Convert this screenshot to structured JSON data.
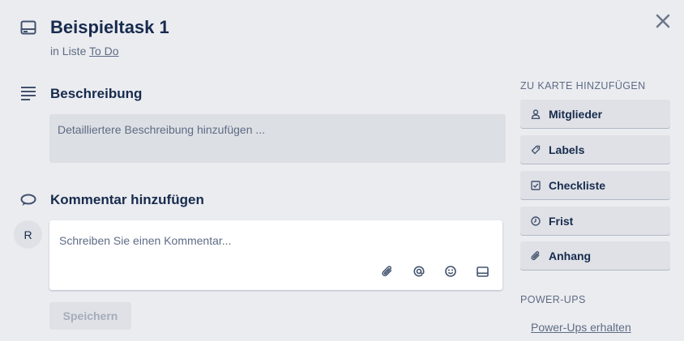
{
  "card": {
    "title": "Beispieltask 1",
    "list_prefix": "in Liste",
    "list_name": "To Do"
  },
  "description": {
    "heading": "Beschreibung",
    "placeholder": "Detailliertere Beschreibung hinzufügen ..."
  },
  "comment": {
    "heading": "Kommentar hinzufügen",
    "avatar_initial": "R",
    "placeholder": "Schreiben Sie einen Kommentar...",
    "save_label": "Speichern",
    "icons": [
      "paperclip-icon",
      "at-mention-icon",
      "emoji-icon",
      "card-icon"
    ]
  },
  "sidebar": {
    "add_heading": "ZU KARTE HINZUFÜGEN",
    "buttons": [
      {
        "label": "Mitglieder",
        "icon": "person-icon"
      },
      {
        "label": "Labels",
        "icon": "tag-icon"
      },
      {
        "label": "Checkliste",
        "icon": "checkbox-icon"
      },
      {
        "label": "Frist",
        "icon": "clock-icon"
      },
      {
        "label": "Anhang",
        "icon": "paperclip-icon"
      }
    ],
    "powerups_heading": "POWER-UPS",
    "powerups_link": "Power-Ups erhalten"
  },
  "colors": {
    "background": "#ebecf0",
    "text": "#172b4d",
    "subtle_text": "#5e6c84",
    "button_bg": "#dfe1e6"
  }
}
